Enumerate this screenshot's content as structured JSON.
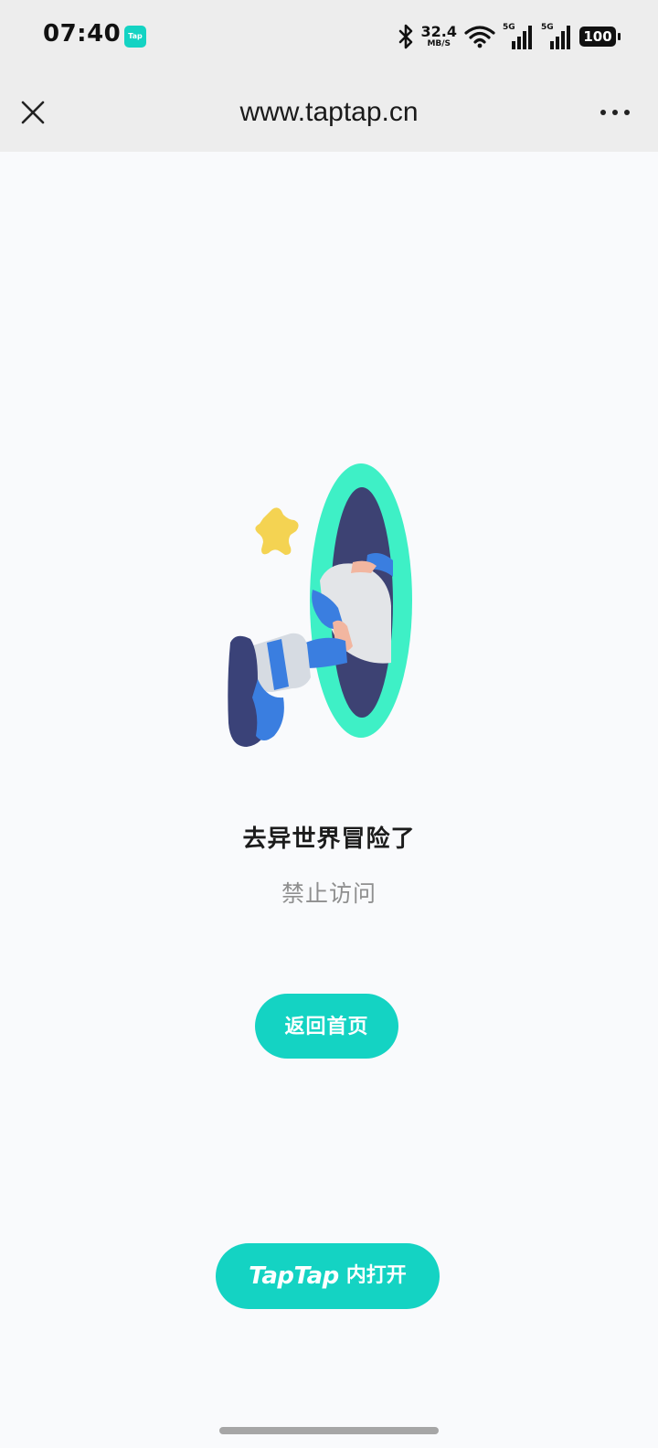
{
  "status_bar": {
    "time": "07:40",
    "app_badge": "Tap",
    "net_speed_value": "32.4",
    "net_speed_unit": "MB/S",
    "sim1_label": "5G",
    "sim2_label": "5G",
    "battery": "100"
  },
  "nav": {
    "close_icon": "close-icon",
    "title": "www.taptap.cn",
    "more_icon": "more-dots-icon"
  },
  "content": {
    "illustration": "portal-leg-illustration",
    "heading": "去异世界冒险了",
    "subtext": "禁止访问",
    "home_button": "返回首页",
    "open_button_brand": "TapTap",
    "open_button_suffix": "内打开"
  },
  "colors": {
    "accent": "#14d3c3",
    "portal_ring": "#3ef0c6",
    "portal_inner": "#3d4273",
    "sparkle": "#f4d352"
  }
}
